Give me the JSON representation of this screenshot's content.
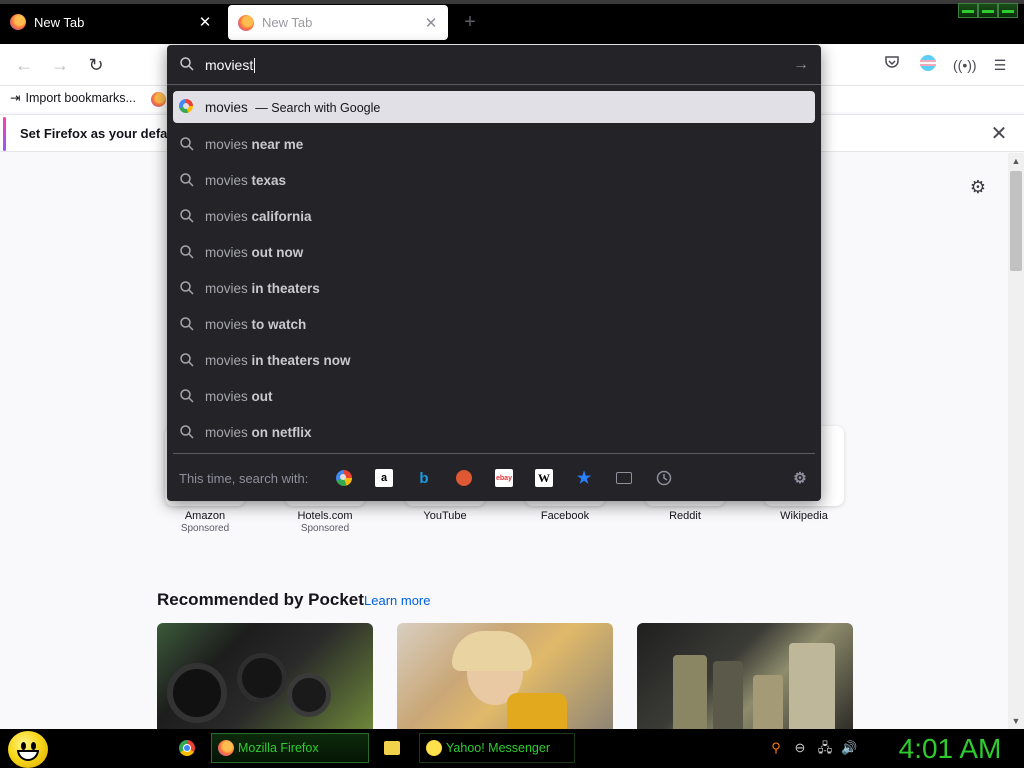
{
  "tabs": [
    {
      "label": "New Tab",
      "active": false
    },
    {
      "label": "New Tab",
      "active": true
    }
  ],
  "bookmarks": {
    "import_label": "Import bookmarks..."
  },
  "notification": {
    "text": "Set Firefox as your default"
  },
  "urlbar": {
    "typed": "moviest",
    "suggestions": [
      {
        "base": "movies",
        "rest": "",
        "action": "— Search with Google",
        "icon": "google-icon",
        "selected": true
      },
      {
        "base": "movies",
        "rest": "near me",
        "icon": "search-icon"
      },
      {
        "base": "movies",
        "rest": "texas",
        "icon": "search-icon"
      },
      {
        "base": "movies",
        "rest": "california",
        "icon": "search-icon"
      },
      {
        "base": "movies",
        "rest": "out now",
        "icon": "search-icon"
      },
      {
        "base": "movies",
        "rest": "in theaters",
        "icon": "search-icon"
      },
      {
        "base": "movies",
        "rest": "to watch",
        "icon": "search-icon"
      },
      {
        "base": "movies",
        "rest": "in theaters now",
        "icon": "search-icon"
      },
      {
        "base": "movies",
        "rest": "out",
        "icon": "search-icon"
      },
      {
        "base": "movies",
        "rest": "on netflix",
        "icon": "search-icon"
      }
    ],
    "this_time_label": "This time, search with:",
    "engines": [
      "Google",
      "Amazon",
      "Bing",
      "DuckDuckGo",
      "eBay",
      "Wikipedia",
      "Bookmarks",
      "Tabs",
      "History"
    ]
  },
  "top_sites": [
    {
      "name": "Amazon",
      "sponsored": "Sponsored"
    },
    {
      "name": "Hotels.com",
      "sponsored": "Sponsored"
    },
    {
      "name": "YouTube",
      "sponsored": ""
    },
    {
      "name": "Facebook",
      "sponsored": ""
    },
    {
      "name": "Reddit",
      "sponsored": ""
    },
    {
      "name": "Wikipedia",
      "sponsored": ""
    }
  ],
  "pocket": {
    "title": "Recommended by Pocket",
    "learn_more": "Learn more"
  },
  "taskbar": {
    "firefox_label": "Mozilla Firefox",
    "yahoo_label": "Yahoo! Messenger",
    "clock": "4:01 AM"
  },
  "colors": {
    "accent_green": "#2ecc2e",
    "panel_bg": "#232328",
    "link_blue": "#0061e0"
  }
}
